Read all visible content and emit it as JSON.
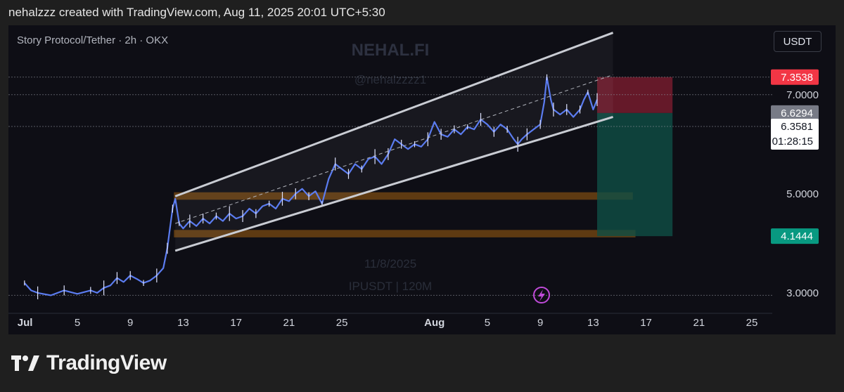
{
  "header": {
    "text": "nehalzzz created with TradingView.com, Aug 11, 2025 20:01 UTC+5:30"
  },
  "chart_header": {
    "symbol": "Story Protocol/Tether · 2h · OKX",
    "currency_button": "USDT"
  },
  "watermark": {
    "title": "NEHAL.FI",
    "handle": "@nehalzzzz1",
    "date": "11/8/2025",
    "pair": "IPUSDT | 120M"
  },
  "brand": {
    "name": "TradingView"
  },
  "colors": {
    "background": "#0e0e15",
    "candle": "#5b7cf0",
    "channel": "#c9ccd3",
    "zone": "#7a4a12",
    "stop": "#7c1d2e",
    "target": "#0f4f45",
    "stop_tag": "#f23645",
    "target_tag": "#089981"
  },
  "chart_data": {
    "type": "line",
    "title": "Story Protocol/Tether · 2h · OKX",
    "xlabel": "",
    "ylabel": "",
    "x_ticks": [
      "Jul",
      "5",
      "9",
      "13",
      "17",
      "21",
      "25",
      "Aug",
      "5",
      "9",
      "13",
      "17",
      "21",
      "25"
    ],
    "y_ticks": [
      "7.0000",
      "5.0000",
      "3.0000"
    ],
    "ylim": [
      2.8,
      8.4
    ],
    "grid": false,
    "series": [
      {
        "values": [
          [
            1,
            3.2
          ],
          [
            1.5,
            3.05
          ],
          [
            2,
            3.0
          ],
          [
            3,
            2.95
          ],
          [
            4,
            3.05
          ],
          [
            5,
            2.98
          ],
          [
            6,
            3.05
          ],
          [
            6.5,
            3.0
          ],
          [
            7,
            3.1
          ],
          [
            7.5,
            3.15
          ],
          [
            8,
            3.3
          ],
          [
            8.5,
            3.22
          ],
          [
            9,
            3.35
          ],
          [
            9.5,
            3.28
          ],
          [
            10,
            3.2
          ],
          [
            10.5,
            3.25
          ],
          [
            11,
            3.35
          ],
          [
            11.5,
            3.5
          ],
          [
            11.8,
            3.9
          ],
          [
            12,
            4.3
          ],
          [
            12.2,
            4.7
          ],
          [
            12.4,
            4.9
          ],
          [
            12.7,
            4.4
          ],
          [
            13,
            4.3
          ],
          [
            13.5,
            4.45
          ],
          [
            14,
            4.35
          ],
          [
            14.5,
            4.5
          ],
          [
            15,
            4.4
          ],
          [
            15.5,
            4.55
          ],
          [
            16,
            4.45
          ],
          [
            16.5,
            4.6
          ],
          [
            17,
            4.5
          ],
          [
            17.5,
            4.55
          ],
          [
            18,
            4.7
          ],
          [
            18.5,
            4.6
          ],
          [
            19,
            4.75
          ],
          [
            19.5,
            4.8
          ],
          [
            20,
            4.7
          ],
          [
            20.5,
            4.9
          ],
          [
            21,
            4.85
          ],
          [
            21.5,
            5.0
          ],
          [
            22,
            5.1
          ],
          [
            22.5,
            4.95
          ],
          [
            23,
            5.05
          ],
          [
            23.5,
            4.8
          ],
          [
            24,
            5.3
          ],
          [
            24.5,
            5.6
          ],
          [
            25,
            5.5
          ],
          [
            25.5,
            5.4
          ],
          [
            26,
            5.6
          ],
          [
            26.5,
            5.5
          ],
          [
            27,
            5.7
          ],
          [
            27.5,
            5.75
          ],
          [
            28,
            5.6
          ],
          [
            28.5,
            5.8
          ],
          [
            29,
            6.1
          ],
          [
            29.5,
            6.0
          ],
          [
            30,
            5.9
          ],
          [
            30.5,
            6.0
          ],
          [
            31,
            5.95
          ],
          [
            31.5,
            6.1
          ],
          [
            32,
            6.45
          ],
          [
            32.5,
            6.2
          ],
          [
            33,
            6.15
          ],
          [
            33.5,
            6.3
          ],
          [
            34,
            6.2
          ],
          [
            34.5,
            6.35
          ],
          [
            35,
            6.3
          ],
          [
            35.5,
            6.5
          ],
          [
            36,
            6.4
          ],
          [
            36.5,
            6.25
          ],
          [
            37,
            6.4
          ],
          [
            37.5,
            6.3
          ],
          [
            38,
            6.1
          ],
          [
            38.3,
            6.0
          ],
          [
            38.6,
            6.1
          ],
          [
            39,
            6.2
          ],
          [
            39.5,
            6.3
          ],
          [
            40,
            6.4
          ],
          [
            40.3,
            6.85
          ],
          [
            40.5,
            7.35
          ],
          [
            40.8,
            6.9
          ],
          [
            41,
            6.7
          ],
          [
            41.5,
            6.6
          ],
          [
            42,
            6.7
          ],
          [
            42.5,
            6.55
          ],
          [
            43,
            6.7
          ],
          [
            43.3,
            6.9
          ],
          [
            43.6,
            7.05
          ],
          [
            44,
            6.7
          ],
          [
            44.3,
            6.9
          ]
        ]
      }
    ],
    "annotations": {
      "channel_upper": [
        [
          12.4,
          4.95
        ],
        [
          45.5,
          8.25
        ]
      ],
      "channel_lower": [
        [
          12.4,
          3.85
        ],
        [
          45.5,
          6.55
        ]
      ],
      "channel_mid": [
        [
          12.4,
          4.4
        ],
        [
          45.5,
          7.4
        ]
      ],
      "support_zones": [
        [
          4.88,
          5.03
        ],
        [
          4.12,
          4.27
        ]
      ],
      "stop_loss_box": {
        "from_x": 44.3,
        "to_x": 50,
        "y0": 6.6294,
        "y1": 7.3538
      },
      "take_profit_box": {
        "from_x": 44.3,
        "to_x": 50,
        "y0": 4.1444,
        "y1": 6.6294
      }
    },
    "price_tags": [
      {
        "label": "7.3538",
        "kind": "stop",
        "y": 7.3538
      },
      {
        "label": "6.6294",
        "kind": "entry",
        "y": 6.6294
      },
      {
        "label": "6.3581",
        "kind": "current",
        "y": 6.3581,
        "sub": "01:28:15"
      },
      {
        "label": "4.1444",
        "kind": "target",
        "y": 4.1444
      }
    ]
  }
}
